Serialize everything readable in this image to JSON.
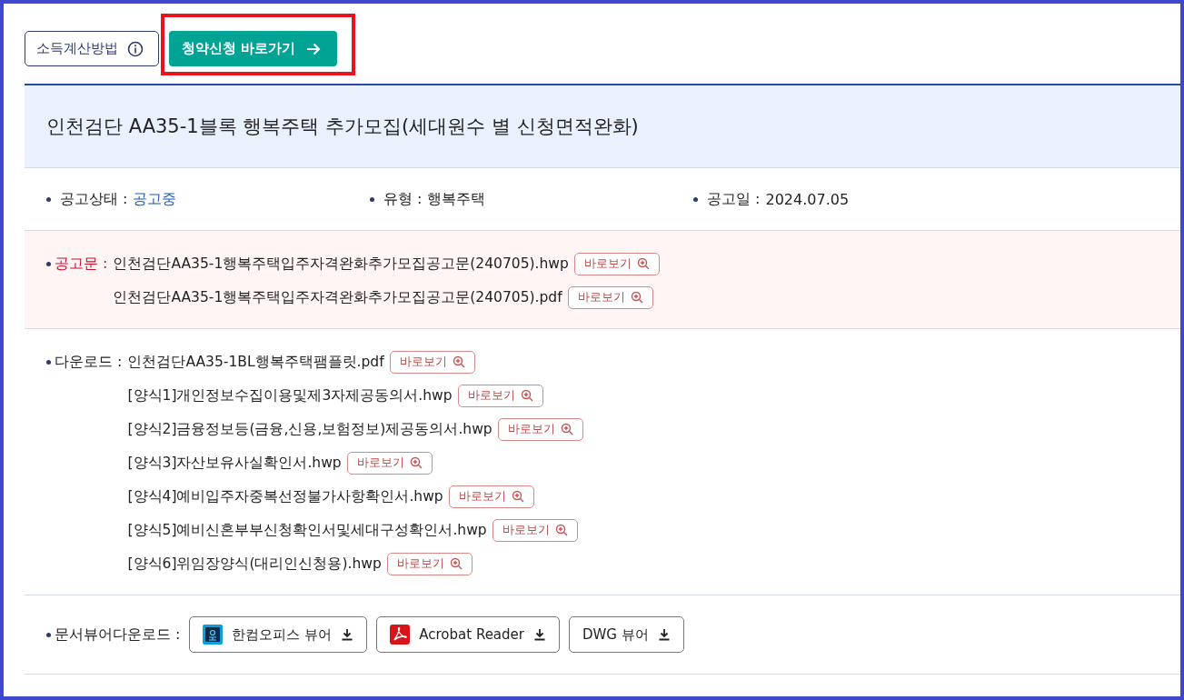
{
  "top_buttons": [
    {
      "label": "소득계산방법",
      "kind": "info",
      "highlighted": false
    },
    {
      "label": "청약신청 바로가기",
      "kind": "primary",
      "highlighted": true
    }
  ],
  "title": "인천검단 AA35-1블록 행복주택 추가모집(세대원수 별 신청면적완화)",
  "info": [
    {
      "label": "공고상태 :",
      "value": "공고중",
      "kind": "status"
    },
    {
      "label": "유형 :",
      "value": "행복주택",
      "kind": "plain"
    },
    {
      "label": "공고일 :",
      "value": "2024.07.05",
      "kind": "plain"
    }
  ],
  "notice": {
    "label": "공고문 :",
    "files": [
      {
        "name": "인천검단AA35-1행복주택입주자격완화추가모집공고문(240705).hwp",
        "button": "바로보기"
      },
      {
        "name": "인천검단AA35-1행복주택입주자격완화추가모집공고문(240705).pdf",
        "button": "바로보기"
      }
    ]
  },
  "downloads": {
    "label": "다운로드 :",
    "files": [
      {
        "name": "인천검단AA35-1BL행복주택팸플릿.pdf",
        "button": "바로보기"
      },
      {
        "name": "[양식1]개인정보수집이용및제3자제공동의서.hwp",
        "button": "바로보기"
      },
      {
        "name": "[양식2]금융정보등(금융,신용,보험정보)제공동의서.hwp",
        "button": "바로보기"
      },
      {
        "name": "[양식3]자산보유사실확인서.hwp",
        "button": "바로보기"
      },
      {
        "name": "[양식4]예비입주자중복선정불가사항확인서.hwp",
        "button": "바로보기"
      },
      {
        "name": "[양식5]예비신혼부부신청확인서및세대구성확인서.hwp",
        "button": "바로보기"
      },
      {
        "name": "[양식6]위임장양식(대리인신청용).hwp",
        "button": "바로보기"
      }
    ]
  },
  "viewers": {
    "label": "문서뷰어다운로드 :",
    "buttons": [
      {
        "label": "한컴오피스 뷰어",
        "kind": "hancom"
      },
      {
        "label": "Acrobat Reader",
        "kind": "acrobat"
      },
      {
        "label": "DWG 뷰어",
        "kind": "plain"
      }
    ]
  }
}
